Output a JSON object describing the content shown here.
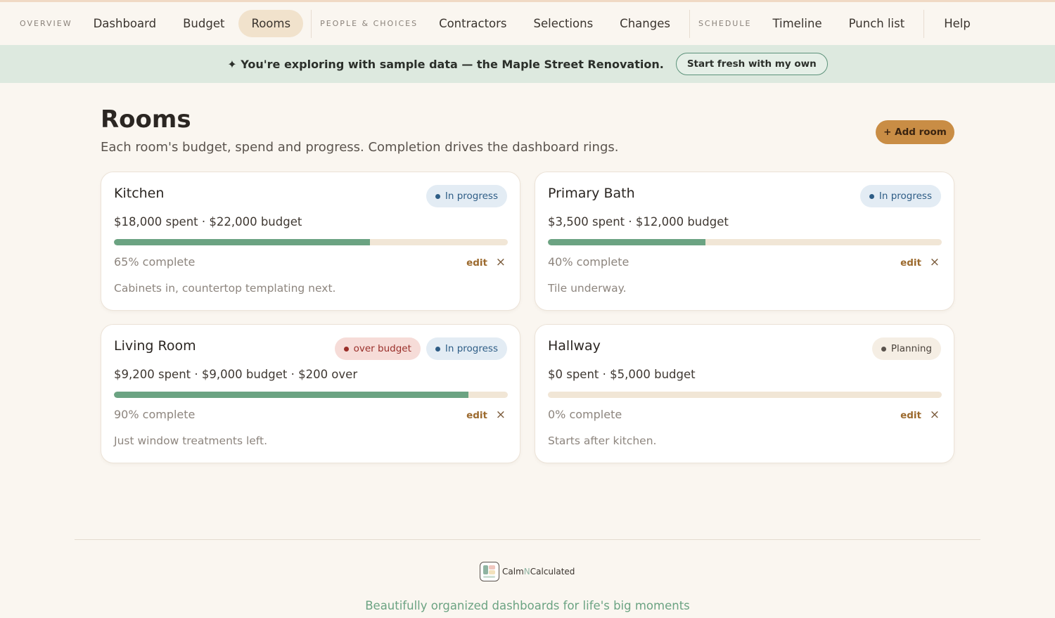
{
  "nav": {
    "groups": [
      {
        "label": "OVERVIEW",
        "items": [
          "Dashboard",
          "Budget",
          "Rooms"
        ]
      },
      {
        "label": "PEOPLE & CHOICES",
        "items": [
          "Contractors",
          "Selections",
          "Changes"
        ]
      },
      {
        "label": "SCHEDULE",
        "items": [
          "Timeline",
          "Punch list"
        ]
      }
    ],
    "help": "Help",
    "active": "Rooms"
  },
  "banner": {
    "icon": "sparkle-icon",
    "text": "✦ You're exploring with sample data — the Maple Street Renovation.",
    "button": "Start fresh with my own"
  },
  "page": {
    "title": "Rooms",
    "subtitle": "Each room's budget, spend and progress. Completion drives the dashboard rings.",
    "add_button": "+ Add room"
  },
  "rooms": [
    {
      "name": "Kitchen",
      "badges": [
        {
          "text": "In progress",
          "kind": "progress"
        }
      ],
      "spend": "$18,000 spent · $22,000 budget",
      "progress": 0.65,
      "complete": "65% complete",
      "note": "Cabinets in, countertop templating next."
    },
    {
      "name": "Primary Bath",
      "badges": [
        {
          "text": "In progress",
          "kind": "progress"
        }
      ],
      "spend": "$3,500 spent · $12,000 budget",
      "progress": 0.4,
      "complete": "40% complete",
      "note": "Tile underway."
    },
    {
      "name": "Living Room",
      "badges": [
        {
          "text": "over budget",
          "kind": "over"
        },
        {
          "text": "In progress",
          "kind": "progress"
        }
      ],
      "spend": "$9,200 spent · $9,000 budget · $200 over",
      "progress": 0.9,
      "complete": "90% complete",
      "note": "Just window treatments left."
    },
    {
      "name": "Hallway",
      "badges": [
        {
          "text": "Planning",
          "kind": "planning"
        }
      ],
      "spend": "$0 spent · $5,000 budget",
      "progress": 0,
      "complete": "0% complete",
      "note": "Starts after kitchen."
    }
  ],
  "card_actions": {
    "edit": "edit",
    "remove": "×"
  },
  "footer": {
    "logo_part1": "Calm",
    "logo_part2": "N",
    "logo_part3": "Calculated",
    "tagline": "Beautifully organized dashboards for life's big moments"
  },
  "colors": {
    "accent": "#c98d45",
    "progress_fill": "#6ba382",
    "progress_track": "#f1e6d6",
    "banner_bg": "#dde9df",
    "badge_progress": "#2e5d86",
    "badge_over": "#9a2f2a"
  }
}
